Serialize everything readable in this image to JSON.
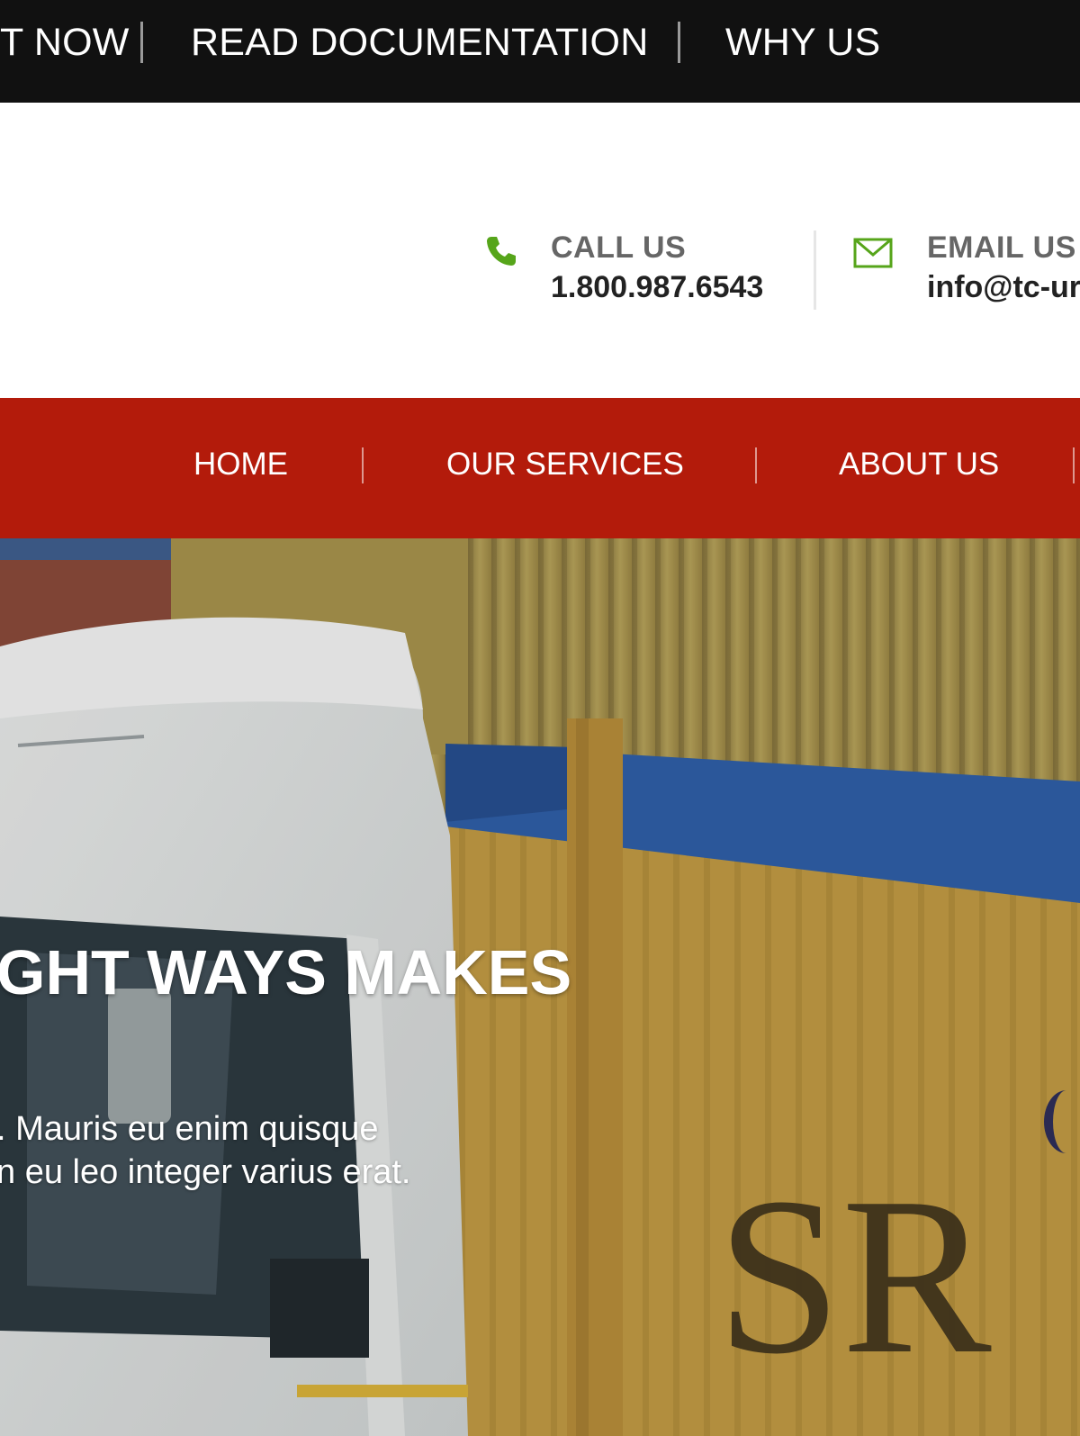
{
  "topbar": {
    "links": [
      "T NOW",
      "READ DOCUMENTATION",
      "WHY US"
    ]
  },
  "contact": {
    "call_label": "CALL US",
    "call_value": "1.800.987.6543",
    "call_icon": "phone-icon",
    "email_label": "EMAIL US",
    "email_value": "info@tc-ur",
    "email_icon": "envelope-icon",
    "icon_color": "#56a51a"
  },
  "mainnav": {
    "items": [
      "HOME",
      "OUR SERVICES",
      "ABOUT US"
    ],
    "background": "#b31b0b"
  },
  "hero": {
    "title": "GHT WAYS MAKES",
    "text_lines": ". Mauris eu enim quisque|n eu leo integer varius erat.",
    "text_line1": ". Mauris eu enim quisque",
    "text_line2": "n eu leo integer varius erat.",
    "container_logo": "SR"
  }
}
